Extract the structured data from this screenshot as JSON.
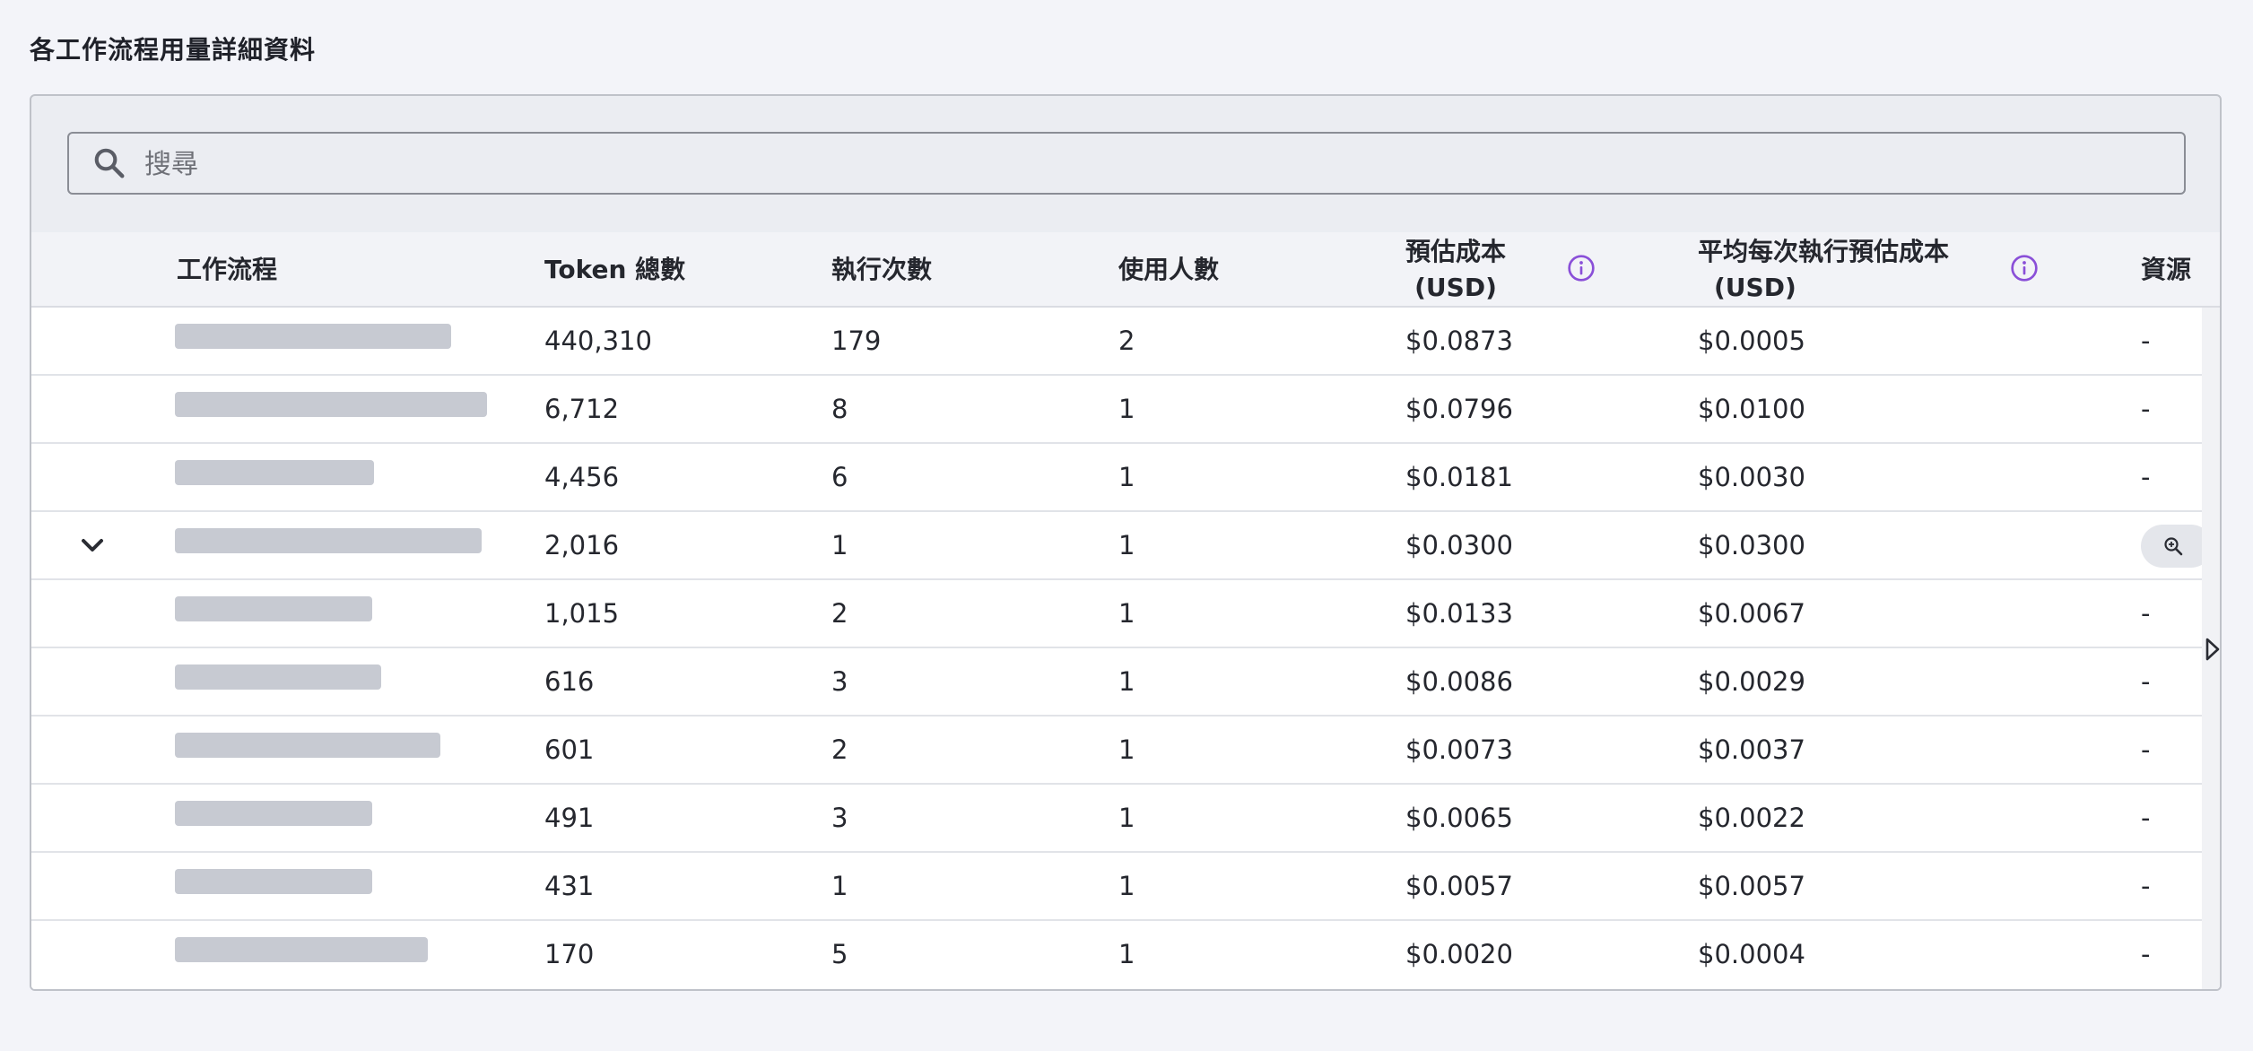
{
  "page": {
    "title": "各工作流程用量詳細資料"
  },
  "search": {
    "placeholder": "搜尋",
    "icon": "search-icon"
  },
  "table": {
    "columns": {
      "workflow": "工作流程",
      "tokens": "Token 總數",
      "runs": "執行次數",
      "users": "使用人數",
      "est_cost_line1": "預估成本",
      "est_cost_line2": "(USD)",
      "avg_cost_line1": "平均每次執行預估成本",
      "avg_cost_line2": "(USD)",
      "resource": "資源"
    },
    "rows": [
      {
        "tokens": "440,310",
        "runs": "179",
        "users": "2",
        "cost": "$0.0873",
        "avg": "$0.0005",
        "resource": "-"
      },
      {
        "tokens": "6,712",
        "runs": "8",
        "users": "1",
        "cost": "$0.0796",
        "avg": "$0.0100",
        "resource": "-"
      },
      {
        "tokens": "4,456",
        "runs": "6",
        "users": "1",
        "cost": "$0.0181",
        "avg": "$0.0030",
        "resource": "-"
      },
      {
        "tokens": "2,016",
        "runs": "1",
        "users": "1",
        "cost": "$0.0300",
        "avg": "$0.0300",
        "resource": ""
      },
      {
        "tokens": "1,015",
        "runs": "2",
        "users": "1",
        "cost": "$0.0133",
        "avg": "$0.0067",
        "resource": "-"
      },
      {
        "tokens": "616",
        "runs": "3",
        "users": "1",
        "cost": "$0.0086",
        "avg": "$0.0029",
        "resource": "-"
      },
      {
        "tokens": "601",
        "runs": "2",
        "users": "1",
        "cost": "$0.0073",
        "avg": "$0.0037",
        "resource": "-"
      },
      {
        "tokens": "491",
        "runs": "3",
        "users": "1",
        "cost": "$0.0065",
        "avg": "$0.0022",
        "resource": "-"
      },
      {
        "tokens": "431",
        "runs": "1",
        "users": "1",
        "cost": "$0.0057",
        "avg": "$0.0057",
        "resource": "-"
      },
      {
        "tokens": "170",
        "runs": "5",
        "users": "1",
        "cost": "$0.0020",
        "avg": "$0.0004",
        "resource": "-"
      }
    ]
  },
  "colors": {
    "accent": "#8a4fd8",
    "background": "#f3f4f9",
    "redacted": "#c7cad2"
  }
}
